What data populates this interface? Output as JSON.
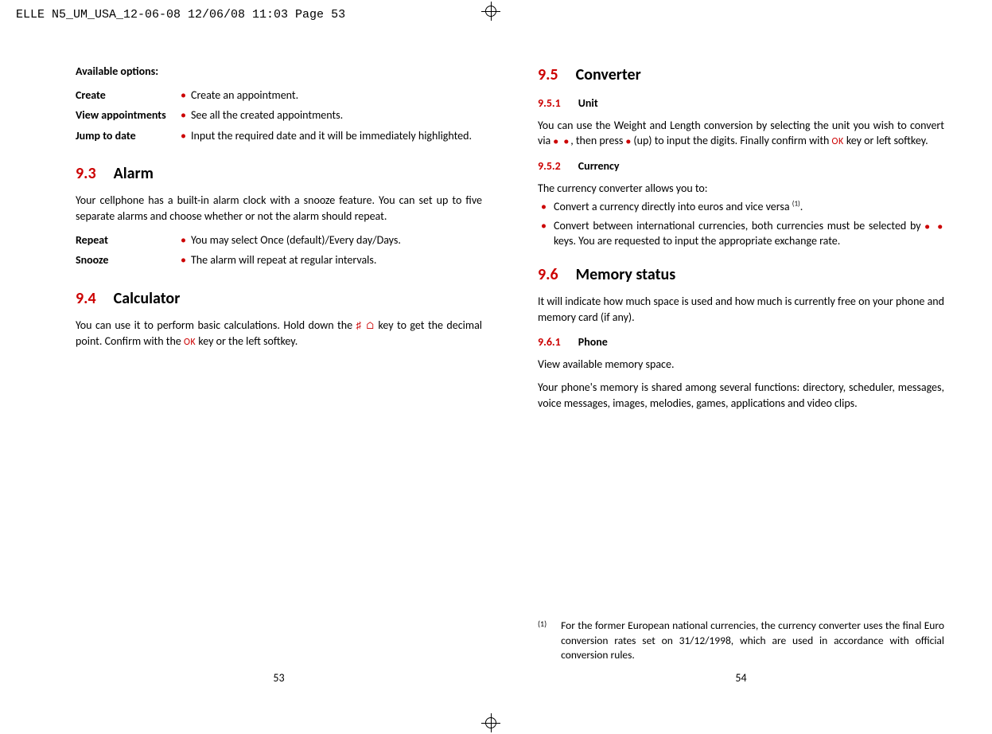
{
  "printHeader": "ELLE N5_UM_USA_12-06-08  12/06/08  11:03  Page 53",
  "left": {
    "availOptions": "Available options:",
    "rows": [
      {
        "term": "Create",
        "desc": "Create an appointment."
      },
      {
        "term": "View appointments",
        "desc": "See all the created appointments."
      },
      {
        "term": "Jump to date",
        "desc": "Input the required date and it will be immediately highlighted."
      }
    ],
    "s93num": "9.3",
    "s93title": "Alarm",
    "s93p": "Your cellphone has a built-in alarm clock with a snooze feature. You can set up to five separate alarms and choose whether or not the alarm should repeat.",
    "alarmRows": [
      {
        "term": "Repeat",
        "desc": "You may select Once (default)/Every day/Days."
      },
      {
        "term": "Snooze",
        "desc": "The alarm will repeat at regular intervals."
      }
    ],
    "s94num": "9.4",
    "s94title": "Calculator",
    "s94p1": "You can use it to perform basic calculations. Hold down the ",
    "s94p2": " key to get the decimal point. Confirm with the ",
    "s94p3": " key or the left softkey.",
    "pageNum": "53"
  },
  "right": {
    "s95num": "9.5",
    "s95title": "Converter",
    "s951num": "9.5.1",
    "s951title": "Unit",
    "s951p1": "You can use the Weight and Length conversion by selecting the unit you wish to convert via ",
    "s951p2": ", then press ",
    "s951p3": " (up) to input the digits. Finally confirm with ",
    "s951p4": " key or left softkey.",
    "s952num": "9.5.2",
    "s952title": "Currency",
    "s952intro": "The currency converter allows you to:",
    "s952li1a": "Convert a currency directly into euros and vice versa ",
    "s952li1b": ".",
    "s952li2a": "Convert between international currencies, both currencies must be selected by ",
    "s952li2b": " keys. You are requested to input the appropriate exchange rate.",
    "s96num": "9.6",
    "s96title": "Memory status",
    "s96p": "It will indicate how much space is used and how much is currently free on your phone and memory card (if any).",
    "s961num": "9.6.1",
    "s961title": "Phone",
    "s961p1": "View available memory space.",
    "s961p2": "Your phone's memory is shared among several functions: directory, scheduler, messages, voice messages, images, melodies, games, applications and video clips.",
    "fnMark": "(1)",
    "fnText": "For the former European national currencies, the currency converter uses the final Euro conversion rates set on 31/12/1998, which are used in accordance with official conversion rules.",
    "pageNum": "54"
  },
  "glyph": {
    "ok": "OK",
    "dots": "● ●",
    "up": "●",
    "hash": "♯ ⌂",
    "sup1": "(1)"
  }
}
